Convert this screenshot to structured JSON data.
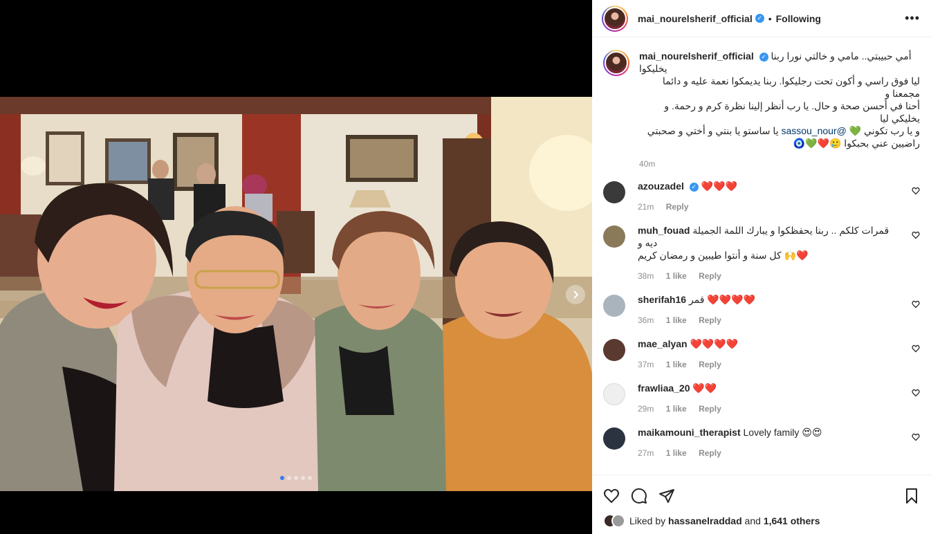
{
  "post": {
    "username": "mai_nourelsherif_official",
    "follow_status": "Following",
    "more_icon": "more-horizontal-icon"
  },
  "caption": {
    "username": "mai_nourelsherif_official",
    "line1": "أمي حبيبتي.. مامي و خالتي نورا ربنا يخليكوا",
    "line2": "ليا فوق راسي و أكون تحت رجليكوا. ربنا يديمكوا نعمة عليه و دائما مجمعنا و",
    "line3": "أحنا في أحسن صحة و حال. يا رب أنظر إلينا نظرة كرم و رحمة. و يخليكي ليا",
    "line4_pre": "و يا رب تكوني 💚 ",
    "mention": "@sassou_nour",
    "line4_post": " يا ساستو يا بنتي و أختي و صحبتي",
    "line5": "راضيين عني بحبكوا 🥲❤️💚🧿",
    "time": "40m"
  },
  "comments": [
    {
      "user": "azouzadel",
      "verified": true,
      "text": "❤️❤️❤️",
      "time": "21m",
      "likes": "",
      "reply": "Reply",
      "avatar_color": "#3a3a3a"
    },
    {
      "user": "muh_fouad",
      "verified": false,
      "text": "قمرات كلكم .. ربنا يحفظكوا و يبارك اللمة الجميلة ديه و",
      "text2": "كل سنة و أنتوا طيبين و رمضان كريم 🙌❤️",
      "time": "38m",
      "likes": "1 like",
      "reply": "Reply",
      "avatar_color": "#8a7a5a"
    },
    {
      "user": "sherifah16",
      "verified": false,
      "text": "قمر ❤️❤️❤️❤️",
      "time": "36m",
      "likes": "1 like",
      "reply": "Reply",
      "avatar_color": "#aab4bd"
    },
    {
      "user": "mae_alyan",
      "verified": false,
      "text": "❤️❤️❤️❤️",
      "time": "37m",
      "likes": "1 like",
      "reply": "Reply",
      "avatar_color": "#5a3a30"
    },
    {
      "user": "frawliaa_20",
      "verified": false,
      "text": "❤️❤️",
      "time": "29m",
      "likes": "1 like",
      "reply": "Reply",
      "avatar_color": "#efefef"
    },
    {
      "user": "maikamouni_therapist",
      "verified": false,
      "text": "Lovely family 😍😍",
      "time": "27m",
      "likes": "1 like",
      "reply": "Reply",
      "avatar_color": "#2c3340"
    }
  ],
  "footer": {
    "liked_by_prefix": "Liked by",
    "liked_by_user": "hassanelraddad",
    "and": "and",
    "others": "1,641 others"
  },
  "colors": {
    "link": "#00376b",
    "muted": "#8e8e8e",
    "verified": "#3897f0",
    "carousel_active": "#2f7bf5"
  },
  "carousel": {
    "count": 5,
    "active": 1
  }
}
